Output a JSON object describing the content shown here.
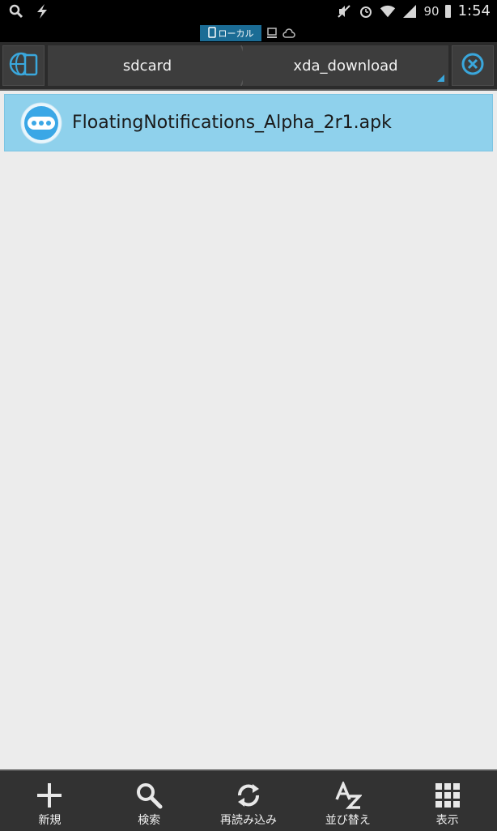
{
  "status_bar": {
    "battery_level": "90",
    "time": "1:54",
    "icons": [
      "search-icon",
      "lightning-icon",
      "mute-icon",
      "alarm-icon",
      "wifi-icon",
      "signal-icon",
      "battery-icon"
    ]
  },
  "location_tabs": {
    "local_label": "ローカル",
    "network_icons": [
      "computer-icon",
      "cloud-icon"
    ]
  },
  "path_bar": {
    "crumbs": [
      "sdcard",
      "xda_download"
    ],
    "left_icon": "globe-device-icon",
    "right_icon": "close-circle-icon",
    "accent_color": "#3aa7dc"
  },
  "files": [
    {
      "name": "FloatingNotifications_Alpha_2r1.apk",
      "icon": "chat-bubble-app-icon",
      "selected": true
    }
  ],
  "toolbar": {
    "items": [
      {
        "label": "新規",
        "icon": "plus-icon"
      },
      {
        "label": "検索",
        "icon": "search-icon"
      },
      {
        "label": "再読み込み",
        "icon": "refresh-icon"
      },
      {
        "label": "並び替え",
        "icon": "sort-az-icon"
      },
      {
        "label": "表示",
        "icon": "grid-view-icon"
      }
    ]
  }
}
